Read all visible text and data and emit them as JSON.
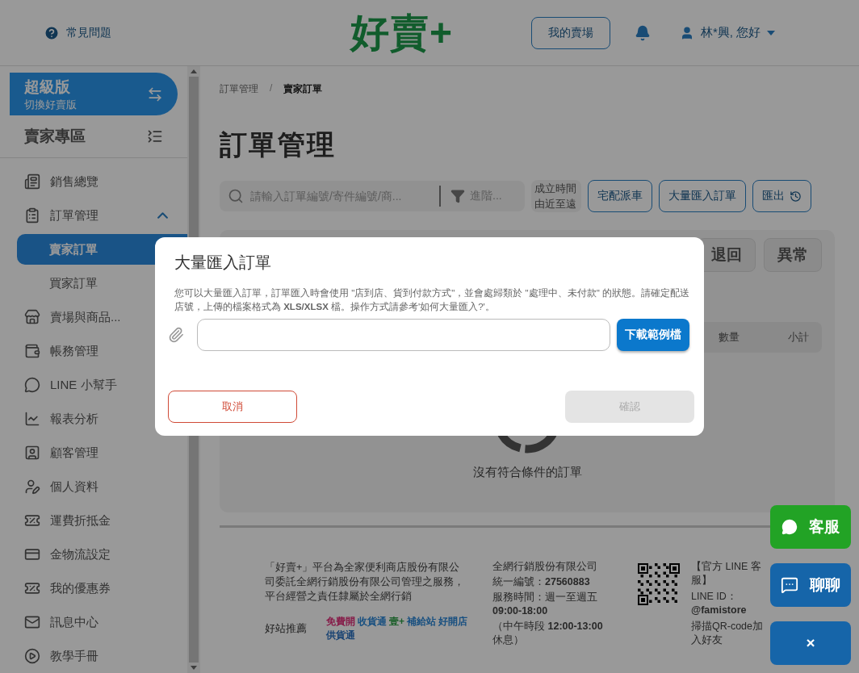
{
  "header": {
    "help_link": "常見問題",
    "logo": "好賣+",
    "my_store_button": "我的賣場",
    "user_menu": "林*興, 您好"
  },
  "sidebar": {
    "plan_card": {
      "title": "超級版",
      "switch_label": "切換好賣版"
    },
    "section_title": "賣家專區",
    "items": [
      {
        "label": "銷售總覽",
        "selected": false
      },
      {
        "label": "訂單管理",
        "selected": false,
        "expanded": true,
        "children": [
          {
            "label": "賣家訂單",
            "selected": true
          },
          {
            "label": "買家訂單",
            "selected": false
          }
        ]
      },
      {
        "label": "賣場與商品...",
        "selected": false
      },
      {
        "label": "帳務管理",
        "selected": false
      },
      {
        "label": "LINE 小幫手",
        "selected": false
      },
      {
        "label": "報表分析",
        "selected": false
      },
      {
        "label": "顧客管理",
        "selected": false
      },
      {
        "label": "個人資料",
        "selected": false
      },
      {
        "label": "運費折抵金",
        "selected": false
      },
      {
        "label": "金物流設定",
        "selected": false
      },
      {
        "label": "我的優惠券",
        "selected": false
      },
      {
        "label": "訊息中心",
        "selected": false
      },
      {
        "label": "教學手冊",
        "selected": false
      }
    ]
  },
  "main": {
    "breadcrumb": [
      "訂單管理",
      "賣家訂單"
    ],
    "breadcrumb_separator": "/",
    "title": "訂單管理",
    "search": {
      "placeholder": "請輸入訂單編號/寄件編號/商..."
    },
    "filter_button": "進階...",
    "sort": "成立時間由近至遠",
    "actions": [
      {
        "kind": "plain",
        "label": "宅配派車"
      },
      {
        "kind": "plain",
        "label": "大量匯入訂單"
      },
      {
        "kind": "history",
        "label": "匯出"
      }
    ],
    "status_tabs": [
      {
        "label": "退回",
        "selected": false
      },
      {
        "label": "異常",
        "selected": false
      }
    ],
    "table": {
      "columns": [
        "數量",
        "小計"
      ]
    },
    "empty_text": "沒有符合條件的訂單"
  },
  "footer": {
    "about": "「好賣+」平台為全家便利商店股份有限公司委託全網行銷股份有限公司管理之服務，平台經營之責任隸屬於全網行銷",
    "recommend_label": "好站推薦",
    "partners": [
      "免費開",
      "收貨通",
      "壹+",
      "補給站",
      "好開店",
      "供貨通"
    ],
    "company": [
      "全網行銷股份有限公司",
      "統一編號：**27560883**",
      "服務時間：週一至週五 **09:00-18:00**",
      "（中午時段 **12:00-13:00** 休息）"
    ],
    "line_info": [
      "【官方 LINE 客服】",
      "LINE ID：**@famistore**",
      "掃描QR-code加入好友"
    ]
  },
  "floating": [
    {
      "kind": "line",
      "label": "客服"
    },
    {
      "kind": "chat",
      "label": "聊聊"
    },
    {
      "kind": "close",
      "label": "×"
    }
  ],
  "modal": {
    "title": "大量匯入訂單",
    "description": "您可以大量匯入訂單，訂單匯入時會使用 \"店到店、貨到付款方式\"，並會處歸類於 \"處理中、未付款\" 的狀態。請確定配送店號，上傳的檔案格式為 **XLS/XLSX** 檔。操作方式請參考'如何大量匯入?'。",
    "download_button": "下載範例檔",
    "cancel_button": "取消",
    "confirm_button": {
      "label": "確認",
      "disabled": true
    }
  }
}
